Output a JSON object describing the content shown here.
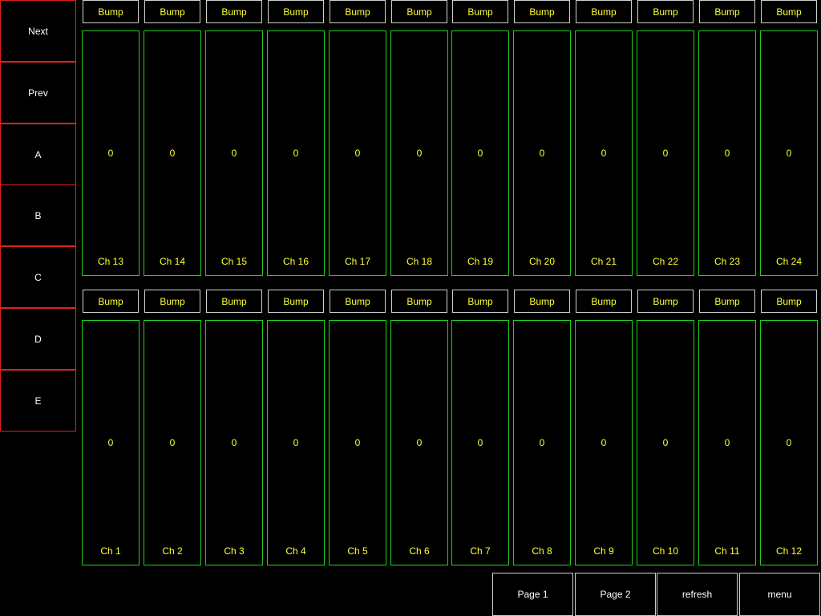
{
  "colors": {
    "background": "#000000",
    "side_border": "#e02020",
    "fader_border": "#22cc22",
    "bump_border": "#cfcfcf",
    "label_text": "#ffff33",
    "button_text": "#ffffff"
  },
  "side_buttons": [
    {
      "label": "Next"
    },
    {
      "label": "Prev"
    },
    {
      "label": "A"
    },
    {
      "label": "B"
    },
    {
      "label": "C"
    },
    {
      "label": "D"
    },
    {
      "label": "E"
    }
  ],
  "banks": [
    {
      "channels": [
        {
          "bump": "Bump",
          "value": "0",
          "label": "Ch 13"
        },
        {
          "bump": "Bump",
          "value": "0",
          "label": "Ch 14"
        },
        {
          "bump": "Bump",
          "value": "0",
          "label": "Ch 15"
        },
        {
          "bump": "Bump",
          "value": "0",
          "label": "Ch 16"
        },
        {
          "bump": "Bump",
          "value": "0",
          "label": "Ch 17"
        },
        {
          "bump": "Bump",
          "value": "0",
          "label": "Ch 18"
        },
        {
          "bump": "Bump",
          "value": "0",
          "label": "Ch 19"
        },
        {
          "bump": "Bump",
          "value": "0",
          "label": "Ch 20"
        },
        {
          "bump": "Bump",
          "value": "0",
          "label": "Ch 21"
        },
        {
          "bump": "Bump",
          "value": "0",
          "label": "Ch 22"
        },
        {
          "bump": "Bump",
          "value": "0",
          "label": "Ch 23"
        },
        {
          "bump": "Bump",
          "value": "0",
          "label": "Ch 24"
        }
      ]
    },
    {
      "channels": [
        {
          "bump": "Bump",
          "value": "0",
          "label": "Ch 1"
        },
        {
          "bump": "Bump",
          "value": "0",
          "label": "Ch 2"
        },
        {
          "bump": "Bump",
          "value": "0",
          "label": "Ch 3"
        },
        {
          "bump": "Bump",
          "value": "0",
          "label": "Ch 4"
        },
        {
          "bump": "Bump",
          "value": "0",
          "label": "Ch 5"
        },
        {
          "bump": "Bump",
          "value": "0",
          "label": "Ch 6"
        },
        {
          "bump": "Bump",
          "value": "0",
          "label": "Ch 7"
        },
        {
          "bump": "Bump",
          "value": "0",
          "label": "Ch 8"
        },
        {
          "bump": "Bump",
          "value": "0",
          "label": "Ch 9"
        },
        {
          "bump": "Bump",
          "value": "0",
          "label": "Ch 10"
        },
        {
          "bump": "Bump",
          "value": "0",
          "label": "Ch 11"
        },
        {
          "bump": "Bump",
          "value": "0",
          "label": "Ch 12"
        }
      ]
    }
  ],
  "nav_buttons": [
    {
      "label": "Page 1"
    },
    {
      "label": "Page 2"
    },
    {
      "label": "refresh"
    },
    {
      "label": "menu"
    }
  ]
}
